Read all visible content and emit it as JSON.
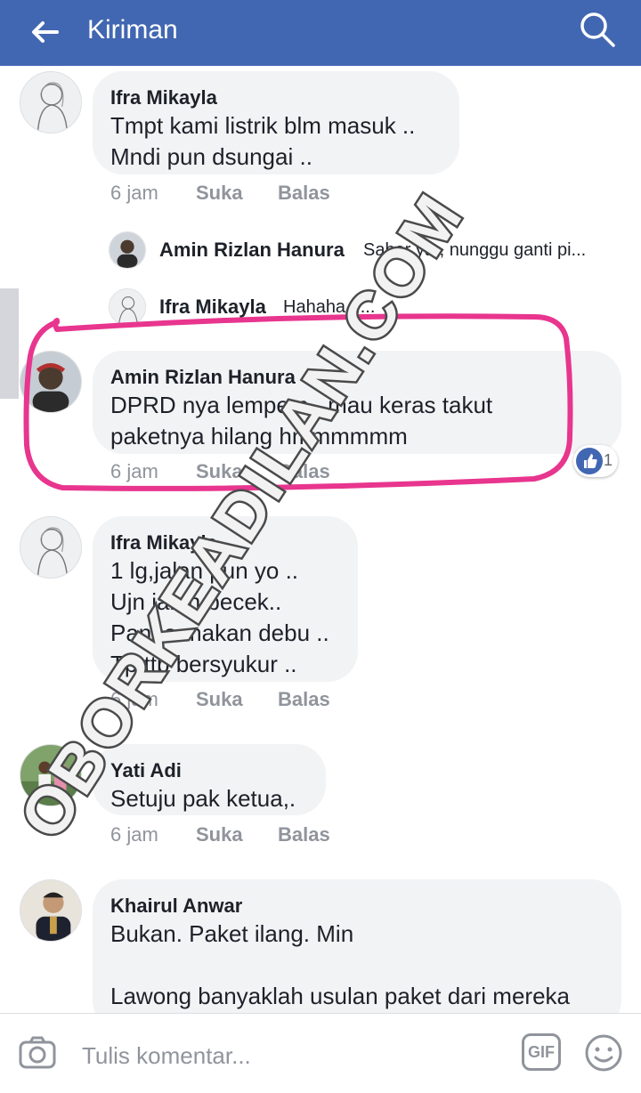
{
  "header": {
    "title": "Kiriman"
  },
  "colors": {
    "header_bg": "#4267b2",
    "highlight": "#e8358e",
    "like_blue": "#4267b2"
  },
  "comments": [
    {
      "name": "Ifra Mikayla",
      "text": "Tmpt kami listrik blm masuk ..\nMndi pun dsungai ..",
      "time": "6 jam",
      "like": "Suka",
      "reply": "Balas"
    },
    {
      "name": "Amin Rizlan Hanura",
      "text": "DPRD nya lempem , mau keras takut\npaketnya hilang hmmmmmm",
      "time": "6 jam",
      "like": "Suka",
      "reply": "Balas",
      "reaction_count": "1"
    },
    {
      "name": "Ifra Mikayla",
      "text": "1 lg,jalan pun yo ..\nUjn jalan becek..\nPanas makan debu ..\nTp ttp bersyukur ..",
      "time": "6 jam",
      "like": "Suka",
      "reply": "Balas"
    },
    {
      "name": "Yati Adi",
      "text": "Setuju pak ketua,.",
      "time": "6 jam",
      "like": "Suka",
      "reply": "Balas"
    },
    {
      "name": "Khairul Anwar",
      "text": "Bukan. Paket ilang. Min\n\nLawong banyaklah usulan paket dari mereka"
    }
  ],
  "replies": [
    {
      "name": "Amin Rizlan Hanura",
      "text": "Sabar ya , nunggu ganti pi..."
    },
    {
      "name": "Ifra Mikayla",
      "text": "Hahaha ....."
    }
  ],
  "composer": {
    "placeholder": "Tulis komentar...",
    "gif_label": "GIF"
  },
  "watermark": "OBORKEADILAN.COM"
}
